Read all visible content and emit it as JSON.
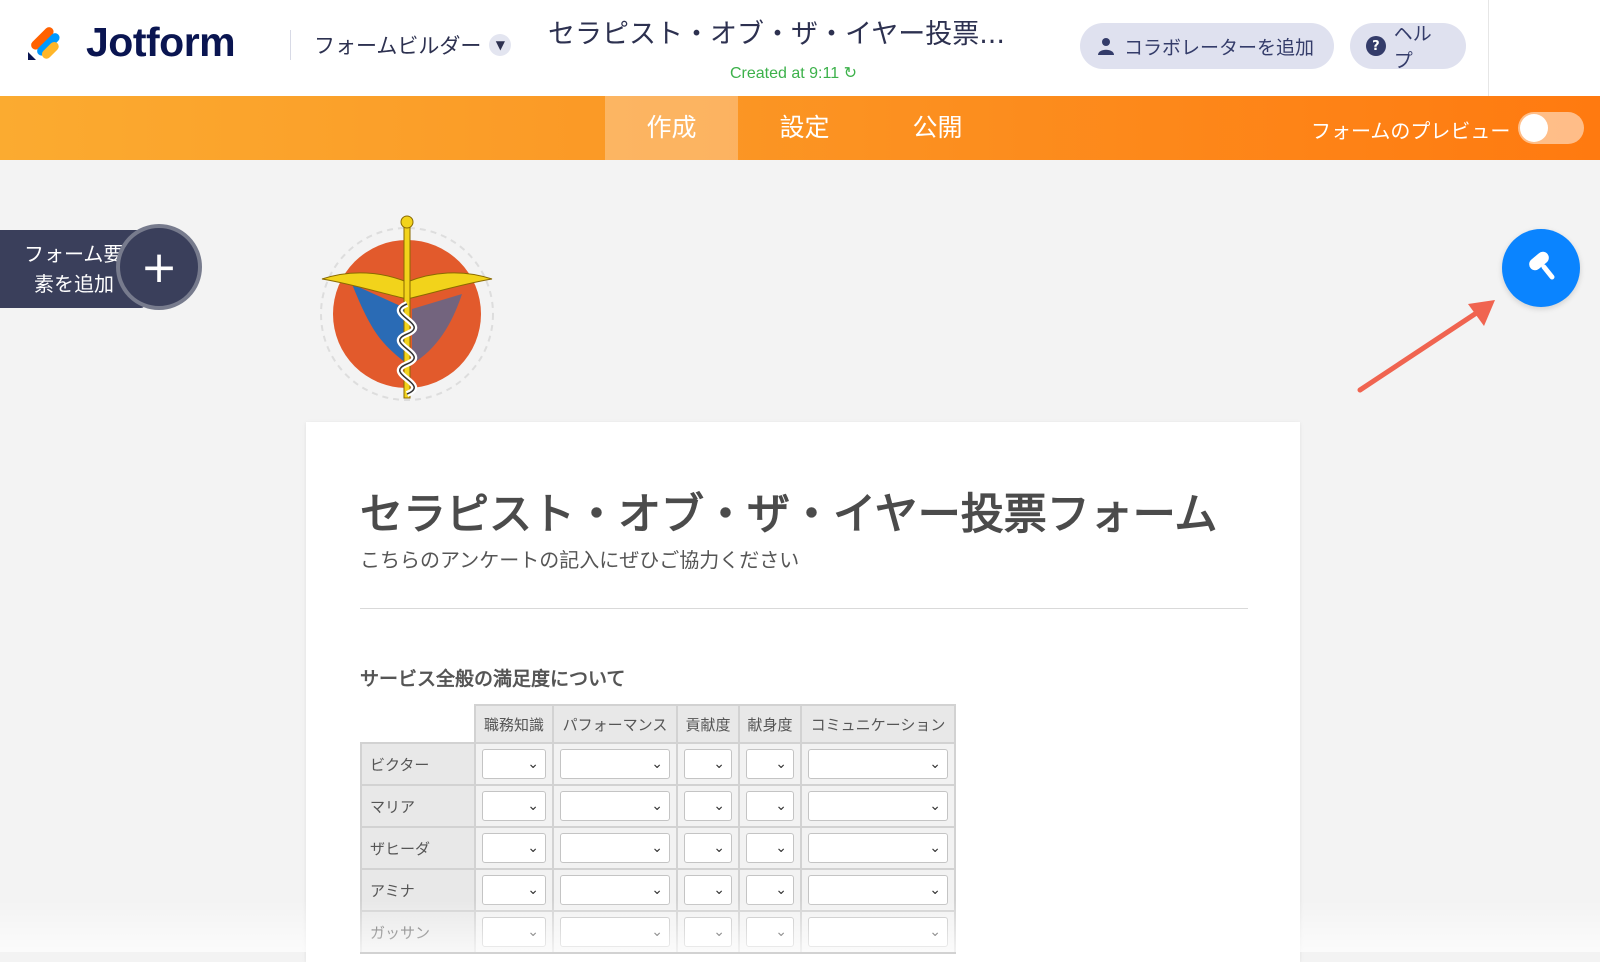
{
  "app": {
    "brand": "Jotform",
    "builder_menu_label": "フォームビルダー",
    "form_title_truncated": "セラピスト・オブ・ザ・イヤー投票...",
    "created_status": "Created at 9:11",
    "add_collaborator_label": "コラボレーターを追加",
    "help_label": "ヘルプ"
  },
  "nav": {
    "tabs": [
      {
        "label": "作成",
        "active": true
      },
      {
        "label": "設定",
        "active": false
      },
      {
        "label": "公開",
        "active": false
      }
    ],
    "preview_label": "フォームのプレビュー",
    "preview_on": false
  },
  "sidebar": {
    "add_element_label_line1": "フォーム要",
    "add_element_label_line2": "素を追加"
  },
  "icons": {
    "form_designer": "paint-roller-icon",
    "collaborator": "user-icon",
    "help": "question-circle-icon",
    "created": "refresh-icon",
    "add": "plus-icon"
  },
  "colors": {
    "brand_navy": "#0a1551",
    "nav_orange": "#ff7a10",
    "fab_blue": "#0a84ff",
    "created_green": "#3cb14a",
    "annotation_arrow": "#f06450"
  },
  "form": {
    "title": "セラピスト・オブ・ザ・イヤー投票フォーム",
    "subtitle": "こちらのアンケートの記入にぜひご協力ください",
    "section_label": "サービス全般の満足度について",
    "matrix": {
      "columns": [
        "職務知識",
        "パフォーマンス",
        "貢献度",
        "献身度",
        "コミュニケーション"
      ],
      "rows": [
        "ビクター",
        "マリア",
        "ザヒーダ",
        "アミナ",
        "ガッサン"
      ],
      "selected_values": [
        [
          "",
          "",
          "",
          "",
          ""
        ],
        [
          "",
          "",
          "",
          "",
          ""
        ],
        [
          "",
          "",
          "",
          "",
          ""
        ],
        [
          "",
          "",
          "",
          "",
          ""
        ],
        [
          "",
          "",
          "",
          "",
          ""
        ]
      ]
    }
  }
}
